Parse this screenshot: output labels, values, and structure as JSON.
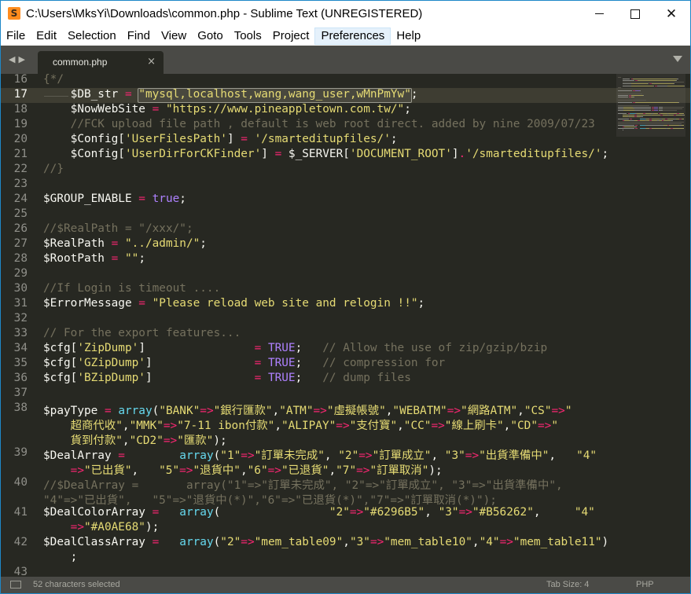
{
  "window": {
    "title": "C:\\Users\\MksYi\\Downloads\\common.php - Sublime Text (UNREGISTERED)",
    "minimize_glyph": "—",
    "maximize_glyph": "☐",
    "close_glyph": "✕"
  },
  "app_icon": {
    "glyph": "S",
    "color": "#ff8c1e"
  },
  "menu": [
    {
      "label": "File"
    },
    {
      "label": "Edit"
    },
    {
      "label": "Selection"
    },
    {
      "label": "Find"
    },
    {
      "label": "View"
    },
    {
      "label": "Goto"
    },
    {
      "label": "Tools"
    },
    {
      "label": "Project"
    },
    {
      "label": "Preferences",
      "active": true
    },
    {
      "label": "Help"
    }
  ],
  "tabbar": {
    "nav_glyph": "◀▶",
    "tab_label": "common.php",
    "tab_close": "×"
  },
  "editor": {
    "current_line": 17,
    "selection": "\"mysql,localhost,wang,wang_user,wMnPmYw\"",
    "colors": {
      "background": "#272822",
      "keyword": "#f92672",
      "string": "#e6db74",
      "comment": "#75715e",
      "constant": "#ae81ff",
      "function": "#66d9ef"
    },
    "lines": [
      {
        "n": "16",
        "tokens": [
          {
            "t": "{*/",
            "c": "cmt"
          }
        ]
      },
      {
        "n": "17",
        "tokens": [
          {
            "t": "    $DB_str",
            "c": "var"
          },
          {
            "t": " = ",
            "c": "op"
          },
          {
            "t": "\"mysql,localhost,wang,wang_user,wMnPmYw\"",
            "c": "str"
          },
          {
            "t": ";",
            "c": "var"
          }
        ]
      },
      {
        "n": "18",
        "tokens": [
          {
            "t": "    $NowWebSite",
            "c": "var"
          },
          {
            "t": " = ",
            "c": "op"
          },
          {
            "t": "\"https://www.pineappletown.com.tw/\"",
            "c": "str"
          },
          {
            "t": ";",
            "c": "var"
          }
        ]
      },
      {
        "n": "19",
        "tokens": [
          {
            "t": "    //FCK upload file path , default is web root direct. added by nine 2009/07/23",
            "c": "cmt"
          }
        ]
      },
      {
        "n": "20",
        "tokens": [
          {
            "t": "    $Config[",
            "c": "var"
          },
          {
            "t": "'UserFilesPath'",
            "c": "str"
          },
          {
            "t": "]",
            "c": "var"
          },
          {
            "t": " = ",
            "c": "op"
          },
          {
            "t": "'/smarteditupfiles/'",
            "c": "str"
          },
          {
            "t": ";",
            "c": "var"
          }
        ]
      },
      {
        "n": "21",
        "tokens": [
          {
            "t": "    $Config[",
            "c": "var"
          },
          {
            "t": "'UserDirForCKFinder'",
            "c": "str"
          },
          {
            "t": "]",
            "c": "var"
          },
          {
            "t": " = ",
            "c": "op"
          },
          {
            "t": "$_SERVER[",
            "c": "var"
          },
          {
            "t": "'DOCUMENT_ROOT'",
            "c": "str"
          },
          {
            "t": "]",
            "c": "var"
          },
          {
            "t": ".",
            "c": "op"
          },
          {
            "t": "'/smarteditupfiles/'",
            "c": "str"
          },
          {
            "t": ";",
            "c": "var"
          }
        ]
      },
      {
        "n": "22",
        "tokens": [
          {
            "t": "//}",
            "c": "cmt"
          }
        ]
      },
      {
        "n": "23",
        "tokens": []
      },
      {
        "n": "24",
        "tokens": [
          {
            "t": "$GROUP_ENABLE",
            "c": "var"
          },
          {
            "t": " = ",
            "c": "op"
          },
          {
            "t": "true",
            "c": "const"
          },
          {
            "t": ";",
            "c": "var"
          }
        ]
      },
      {
        "n": "25",
        "tokens": []
      },
      {
        "n": "26",
        "tokens": [
          {
            "t": "//$RealPath = \"/xxx/\";",
            "c": "cmt"
          }
        ]
      },
      {
        "n": "27",
        "tokens": [
          {
            "t": "$RealPath",
            "c": "var"
          },
          {
            "t": " = ",
            "c": "op"
          },
          {
            "t": "\"../admin/\"",
            "c": "str"
          },
          {
            "t": ";",
            "c": "var"
          }
        ]
      },
      {
        "n": "28",
        "tokens": [
          {
            "t": "$RootPath",
            "c": "var"
          },
          {
            "t": " = ",
            "c": "op"
          },
          {
            "t": "\"\"",
            "c": "str"
          },
          {
            "t": ";",
            "c": "var"
          }
        ]
      },
      {
        "n": "29",
        "tokens": []
      },
      {
        "n": "30",
        "tokens": [
          {
            "t": "//If Login is timeout ....",
            "c": "cmt"
          }
        ]
      },
      {
        "n": "31",
        "tokens": [
          {
            "t": "$ErrorMessage",
            "c": "var"
          },
          {
            "t": " = ",
            "c": "op"
          },
          {
            "t": "\"Please reload web site and relogin !!\"",
            "c": "str"
          },
          {
            "t": ";",
            "c": "var"
          }
        ]
      },
      {
        "n": "32",
        "tokens": []
      },
      {
        "n": "33",
        "tokens": [
          {
            "t": "// For the export features...",
            "c": "cmt"
          }
        ]
      },
      {
        "n": "34",
        "tokens": [
          {
            "t": "$cfg[",
            "c": "var"
          },
          {
            "t": "'ZipDump'",
            "c": "str"
          },
          {
            "t": "]               ",
            "c": "var"
          },
          {
            "t": " = ",
            "c": "op"
          },
          {
            "t": "TRUE",
            "c": "const"
          },
          {
            "t": ";   ",
            "c": "var"
          },
          {
            "t": "// Allow the use of zip/gzip/bzip",
            "c": "cmt"
          }
        ]
      },
      {
        "n": "35",
        "tokens": [
          {
            "t": "$cfg[",
            "c": "var"
          },
          {
            "t": "'GZipDump'",
            "c": "str"
          },
          {
            "t": "]              ",
            "c": "var"
          },
          {
            "t": " = ",
            "c": "op"
          },
          {
            "t": "TRUE",
            "c": "const"
          },
          {
            "t": ";   ",
            "c": "var"
          },
          {
            "t": "// compression for",
            "c": "cmt"
          }
        ]
      },
      {
        "n": "36",
        "tokens": [
          {
            "t": "$cfg[",
            "c": "var"
          },
          {
            "t": "'BZipDump'",
            "c": "str"
          },
          {
            "t": "]              ",
            "c": "var"
          },
          {
            "t": " = ",
            "c": "op"
          },
          {
            "t": "TRUE",
            "c": "const"
          },
          {
            "t": ";   ",
            "c": "var"
          },
          {
            "t": "// dump files",
            "c": "cmt"
          }
        ]
      },
      {
        "n": "37",
        "tokens": []
      },
      {
        "n": "38",
        "tokens": [
          {
            "t": "$payType",
            "c": "var"
          },
          {
            "t": " = ",
            "c": "op"
          },
          {
            "t": "array",
            "c": "fn"
          },
          {
            "t": "(",
            "c": "var"
          },
          {
            "t": "\"BANK\"",
            "c": "str"
          },
          {
            "t": "=>",
            "c": "op"
          },
          {
            "t": "\"銀行匯款\"",
            "c": "str"
          },
          {
            "t": ",",
            "c": "var"
          },
          {
            "t": "\"ATM\"",
            "c": "str"
          },
          {
            "t": "=>",
            "c": "op"
          },
          {
            "t": "\"虛擬帳號\"",
            "c": "str"
          },
          {
            "t": ",",
            "c": "var"
          },
          {
            "t": "\"WEBATM\"",
            "c": "str"
          },
          {
            "t": "=>",
            "c": "op"
          },
          {
            "t": "\"網路ATM\"",
            "c": "str"
          },
          {
            "t": ",",
            "c": "var"
          },
          {
            "t": "\"CS\"",
            "c": "str"
          },
          {
            "t": "=>",
            "c": "op"
          },
          {
            "t": "\"",
            "c": "str"
          }
        ]
      },
      {
        "n": "",
        "tokens": [
          {
            "t": "    超商代收\"",
            "c": "str"
          },
          {
            "t": ",",
            "c": "var"
          },
          {
            "t": "\"MMK\"",
            "c": "str"
          },
          {
            "t": "=>",
            "c": "op"
          },
          {
            "t": "\"7-11 ibon付款\"",
            "c": "str"
          },
          {
            "t": ",",
            "c": "var"
          },
          {
            "t": "\"ALIPAY\"",
            "c": "str"
          },
          {
            "t": "=>",
            "c": "op"
          },
          {
            "t": "\"支付寶\"",
            "c": "str"
          },
          {
            "t": ",",
            "c": "var"
          },
          {
            "t": "\"CC\"",
            "c": "str"
          },
          {
            "t": "=>",
            "c": "op"
          },
          {
            "t": "\"線上刷卡\"",
            "c": "str"
          },
          {
            "t": ",",
            "c": "var"
          },
          {
            "t": "\"CD\"",
            "c": "str"
          },
          {
            "t": "=>",
            "c": "op"
          },
          {
            "t": "\"",
            "c": "str"
          }
        ]
      },
      {
        "n": "",
        "tokens": [
          {
            "t": "    貨到付款\"",
            "c": "str"
          },
          {
            "t": ",",
            "c": "var"
          },
          {
            "t": "\"CD2\"",
            "c": "str"
          },
          {
            "t": "=>",
            "c": "op"
          },
          {
            "t": "\"匯款\"",
            "c": "str"
          },
          {
            "t": ");",
            "c": "var"
          }
        ]
      },
      {
        "n": "39",
        "tokens": [
          {
            "t": "$DealArray",
            "c": "var"
          },
          {
            "t": " = ",
            "c": "op"
          },
          {
            "t": "       ",
            "c": "var"
          },
          {
            "t": "array",
            "c": "fn"
          },
          {
            "t": "(",
            "c": "var"
          },
          {
            "t": "\"1\"",
            "c": "str"
          },
          {
            "t": "=>",
            "c": "op"
          },
          {
            "t": "\"訂單未完成\"",
            "c": "str"
          },
          {
            "t": ", ",
            "c": "var"
          },
          {
            "t": "\"2\"",
            "c": "str"
          },
          {
            "t": "=>",
            "c": "op"
          },
          {
            "t": "\"訂單成立\"",
            "c": "str"
          },
          {
            "t": ", ",
            "c": "var"
          },
          {
            "t": "\"3\"",
            "c": "str"
          },
          {
            "t": "=>",
            "c": "op"
          },
          {
            "t": "\"出貨準備中\"",
            "c": "str"
          },
          {
            "t": ",   ",
            "c": "var"
          },
          {
            "t": "\"4\"",
            "c": "str"
          }
        ]
      },
      {
        "n": "",
        "tokens": [
          {
            "t": "    ",
            "c": "var"
          },
          {
            "t": "=>",
            "c": "op"
          },
          {
            "t": "\"已出貨\"",
            "c": "str"
          },
          {
            "t": ",   ",
            "c": "var"
          },
          {
            "t": "\"5\"",
            "c": "str"
          },
          {
            "t": "=>",
            "c": "op"
          },
          {
            "t": "\"退貨中\"",
            "c": "str"
          },
          {
            "t": ",",
            "c": "var"
          },
          {
            "t": "\"6\"",
            "c": "str"
          },
          {
            "t": "=>",
            "c": "op"
          },
          {
            "t": "\"已退貨\"",
            "c": "str"
          },
          {
            "t": ",",
            "c": "var"
          },
          {
            "t": "\"7\"",
            "c": "str"
          },
          {
            "t": "=>",
            "c": "op"
          },
          {
            "t": "\"訂單取消\"",
            "c": "str"
          },
          {
            "t": ");",
            "c": "var"
          }
        ]
      },
      {
        "n": "40",
        "tokens": [
          {
            "t": "//$DealArray =       array(\"1\"=>\"訂單未完成\", \"2\"=>\"訂單成立\", \"3\"=>\"出貨準備中\",",
            "c": "cmt"
          }
        ]
      },
      {
        "n": "",
        "tokens": [
          {
            "t": "\"4\"=>\"已出貨\",   \"5\"=>\"退貨中(*)\",\"6\"=>\"已退貨(*)\",\"7\"=>\"訂單取消(*)\");",
            "c": "cmt"
          }
        ]
      },
      {
        "n": "41",
        "tokens": [
          {
            "t": "$DealColorArray",
            "c": "var"
          },
          {
            "t": " = ",
            "c": "op"
          },
          {
            "t": "  ",
            "c": "var"
          },
          {
            "t": "array",
            "c": "fn"
          },
          {
            "t": "(                ",
            "c": "var"
          },
          {
            "t": "\"2\"",
            "c": "str"
          },
          {
            "t": "=>",
            "c": "op"
          },
          {
            "t": "\"#6296B5\"",
            "c": "str"
          },
          {
            "t": ", ",
            "c": "var"
          },
          {
            "t": "\"3\"",
            "c": "str"
          },
          {
            "t": "=>",
            "c": "op"
          },
          {
            "t": "\"#B56262\"",
            "c": "str"
          },
          {
            "t": ",     ",
            "c": "var"
          },
          {
            "t": "\"4\"",
            "c": "str"
          }
        ]
      },
      {
        "n": "",
        "tokens": [
          {
            "t": "    ",
            "c": "var"
          },
          {
            "t": "=>",
            "c": "op"
          },
          {
            "t": "\"#A0AE68\"",
            "c": "str"
          },
          {
            "t": ");",
            "c": "var"
          }
        ]
      },
      {
        "n": "42",
        "tokens": [
          {
            "t": "$DealClassArray",
            "c": "var"
          },
          {
            "t": " = ",
            "c": "op"
          },
          {
            "t": "  ",
            "c": "var"
          },
          {
            "t": "array",
            "c": "fn"
          },
          {
            "t": "(",
            "c": "var"
          },
          {
            "t": "\"2\"",
            "c": "str"
          },
          {
            "t": "=>",
            "c": "op"
          },
          {
            "t": "\"mem_table09\"",
            "c": "str"
          },
          {
            "t": ",",
            "c": "var"
          },
          {
            "t": "\"3\"",
            "c": "str"
          },
          {
            "t": "=>",
            "c": "op"
          },
          {
            "t": "\"mem_table10\"",
            "c": "str"
          },
          {
            "t": ",",
            "c": "var"
          },
          {
            "t": "\"4\"",
            "c": "str"
          },
          {
            "t": "=>",
            "c": "op"
          },
          {
            "t": "\"mem_table11\"",
            "c": "str"
          },
          {
            "t": ")",
            "c": "var"
          }
        ]
      },
      {
        "n": "",
        "tokens": [
          {
            "t": "    ;",
            "c": "var"
          }
        ]
      },
      {
        "n": "43",
        "tokens": []
      }
    ]
  },
  "status": {
    "selection_text": "52 characters selected",
    "tab_size": "Tab Size: 4",
    "syntax": "PHP"
  }
}
